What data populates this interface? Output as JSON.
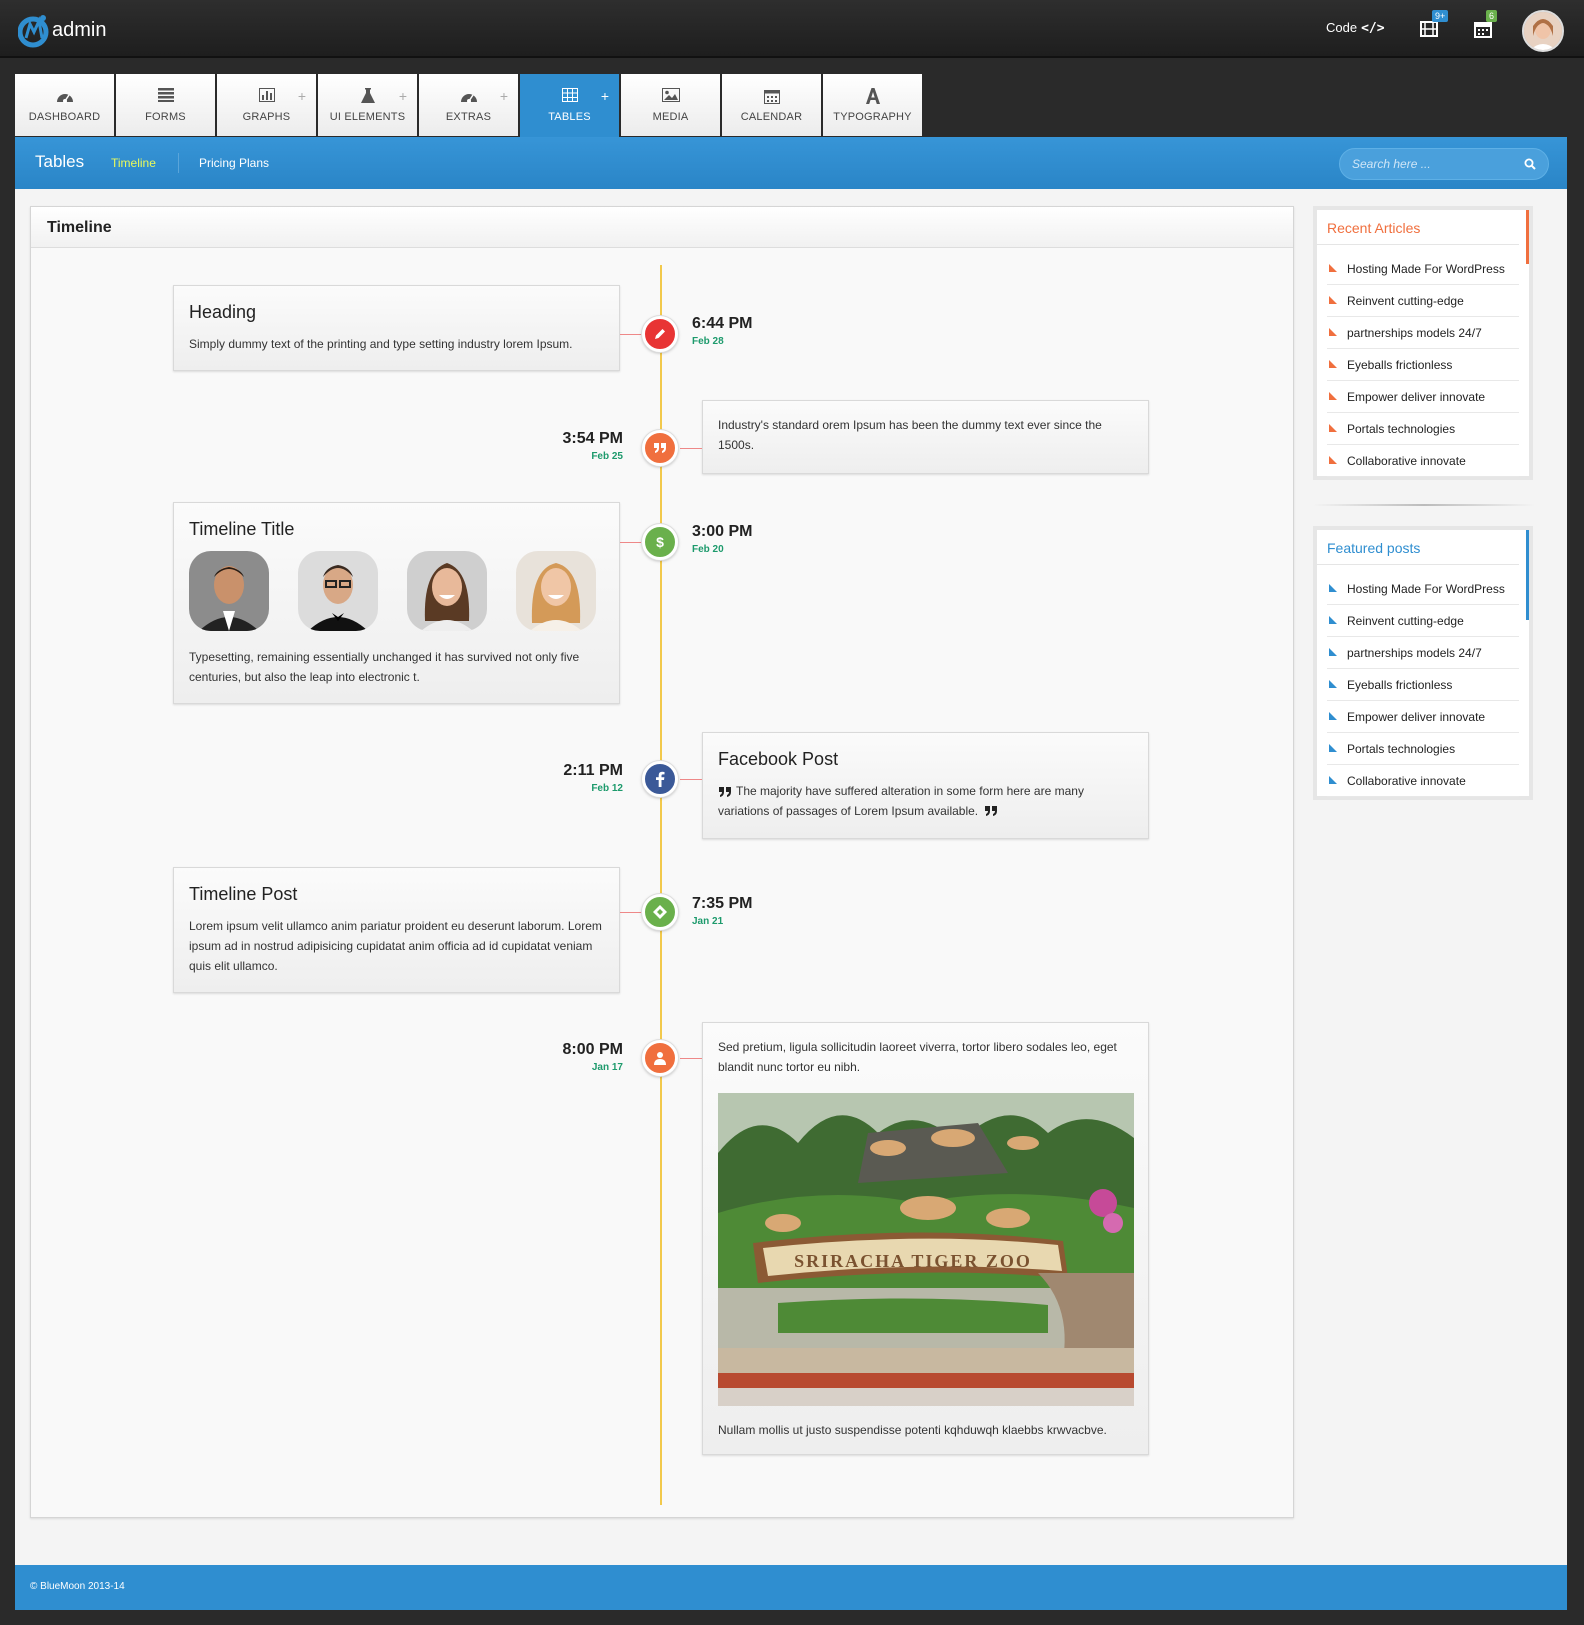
{
  "app": {
    "logo_text": "admin"
  },
  "topbar": {
    "code_label": "Code",
    "code_glyph": "</>",
    "media_badge": "9+",
    "calendar_badge": "6",
    "badge_colors": {
      "media": "#2f8ed0",
      "calendar": "#6ab04c"
    }
  },
  "tabs": [
    {
      "label": "DASHBOARD",
      "icon": "dashboard-icon",
      "plus": ""
    },
    {
      "label": "FORMS",
      "icon": "list-icon",
      "plus": ""
    },
    {
      "label": "GRAPHS",
      "icon": "bar-chart-icon",
      "plus": "+"
    },
    {
      "label": "UI ELEMENTS",
      "icon": "flask-icon",
      "plus": "+"
    },
    {
      "label": "EXTRAS",
      "icon": "dashboard-icon",
      "plus": "+"
    },
    {
      "label": "TABLES",
      "icon": "table-icon",
      "plus": "+",
      "active": true
    },
    {
      "label": "MEDIA",
      "icon": "image-icon",
      "plus": ""
    },
    {
      "label": "CALENDAR",
      "icon": "calendar-icon",
      "plus": ""
    },
    {
      "label": "TYPOGRAPHY",
      "icon": "font-icon",
      "plus": ""
    }
  ],
  "subnav": {
    "title": "Tables",
    "links": [
      {
        "label": "Timeline",
        "active": true
      },
      {
        "label": "Pricing Plans"
      }
    ],
    "search_placeholder": "Search here ..."
  },
  "panel": {
    "title": "Timeline"
  },
  "timeline": [
    {
      "time": "6:44 PM",
      "date": "Feb 28",
      "side": "left",
      "icon": "pencil-icon",
      "color": "#e83434",
      "title": "Heading",
      "text": "Simply dummy text of the printing and type setting industry lorem Ipsum."
    },
    {
      "time": "3:54 PM",
      "date": "Feb 25",
      "side": "right",
      "icon": "quote-icon",
      "color": "#f06f3e",
      "text": "Industry's standard orem Ipsum has been the dummy text ever since the 1500s."
    },
    {
      "time": "3:00 PM",
      "date": "Feb 20",
      "side": "left",
      "icon": "dollar-icon",
      "color": "#6ab04c",
      "title": "Timeline Title",
      "text": "Typesetting, remaining essentially unchanged it has survived not only five centuries, but also the leap into electronic t."
    },
    {
      "time": "2:11 PM",
      "date": "Feb 12",
      "side": "right",
      "icon": "facebook-icon",
      "color": "#3b5998",
      "title": "Facebook Post",
      "text": "The majority have suffered alteration in some form here are many variations of passages of Lorem Ipsum available."
    },
    {
      "time": "7:35 PM",
      "date": "Jan 21",
      "side": "left",
      "icon": "ticket-icon",
      "color": "#6ab04c",
      "title": "Timeline Post",
      "text": "Lorem ipsum velit ullamco anim pariatur proident eu deserunt laborum. Lorem ipsum ad in nostrud adipisicing cupidatat anim officia ad id cupidatat veniam quis elit ullamco."
    },
    {
      "time": "8:00 PM",
      "date": "Jan 17",
      "side": "right",
      "icon": "user-icon",
      "color": "#f06f3e",
      "text": "Sed pretium, ligula sollicitudin laoreet viverra, tortor libero sodales leo, eget blandit nunc tortor eu nibh.",
      "image_sign": "SRIRACHA TIGER ZOO",
      "caption": "Nullam mollis ut justo suspendisse potenti kqhduwqh klaebbs krwvacbve."
    }
  ],
  "recent_articles": {
    "title": "Recent Articles",
    "color": "#f06f3e",
    "items": [
      "Hosting Made For WordPress",
      "Reinvent cutting-edge",
      "partnerships models 24/7",
      "Eyeballs frictionless",
      "Empower deliver innovate",
      "Portals technologies",
      "Collaborative innovate"
    ]
  },
  "featured_posts": {
    "title": "Featured posts",
    "color": "#2f8ed0",
    "items": [
      "Hosting Made For WordPress",
      "Reinvent cutting-edge",
      "partnerships models 24/7",
      "Eyeballs frictionless",
      "Empower deliver innovate",
      "Portals technologies",
      "Collaborative innovate"
    ]
  },
  "footer": {
    "text": "© BlueMoon 2013-14"
  }
}
